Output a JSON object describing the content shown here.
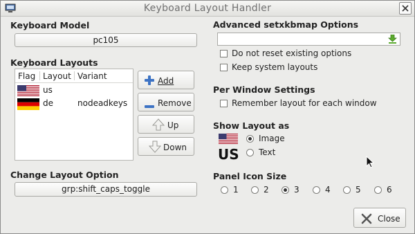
{
  "window": {
    "title": "Keyboard Layout Handler",
    "close_label": "Close"
  },
  "keyboard_model": {
    "heading": "Keyboard Model",
    "value": "pc105"
  },
  "keyboard_layouts": {
    "heading": "Keyboard Layouts",
    "columns": [
      "Flag",
      "Layout",
      "Variant"
    ],
    "rows": [
      {
        "flag_icon": "us-flag-icon",
        "layout": "us",
        "variant": ""
      },
      {
        "flag_icon": "de-flag-icon",
        "layout": "de",
        "variant": "nodeadkeys"
      }
    ],
    "buttons": {
      "add": "Add",
      "remove": "Remove",
      "up": "Up",
      "down": "Down"
    }
  },
  "change_layout_option": {
    "heading": "Change Layout Option",
    "value": "grp:shift_caps_toggle"
  },
  "advanced": {
    "heading": "Advanced setxkbmap Options",
    "input_value": "",
    "options": [
      {
        "label": "Do not reset existing options",
        "checked": false
      },
      {
        "label": "Keep system layouts",
        "checked": false
      }
    ]
  },
  "per_window": {
    "heading": "Per Window Settings",
    "option": {
      "label": "Remember layout for each window",
      "checked": false
    }
  },
  "show_layout": {
    "heading": "Show Layout as",
    "preview_text": "US",
    "options": [
      {
        "label": "Image",
        "selected": true
      },
      {
        "label": "Text",
        "selected": false
      }
    ]
  },
  "panel_icon_size": {
    "heading": "Panel Icon Size",
    "options": [
      "1",
      "2",
      "3",
      "4",
      "5",
      "6"
    ],
    "selected": "3"
  },
  "colors": {
    "window_bg": "#ececea",
    "us_red": "#b22234",
    "us_blue": "#3c3b6e",
    "de_black": "#000000",
    "de_red": "#dd0000",
    "de_gold": "#ffce00"
  }
}
